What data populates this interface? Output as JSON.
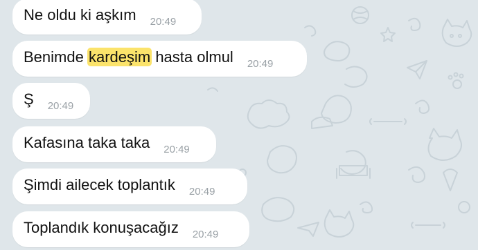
{
  "colors": {
    "wallpaper": "#dfe6ea",
    "bubble": "#ffffff",
    "text": "#111111",
    "time": "#9aa1a6",
    "highlight": "#fbe36b"
  },
  "messages": [
    {
      "text": "Ne oldu ki aşkım",
      "time": "20:49"
    },
    {
      "pre": "Benimde ",
      "highlight": "kardeşim",
      "post": " hasta olmul",
      "time": "20:49"
    },
    {
      "text": "Ş",
      "time": "20:49"
    },
    {
      "text": "Kafasına taka taka",
      "time": "20:49"
    },
    {
      "text": "Şimdi ailecek toplantık",
      "time": "20:49"
    },
    {
      "text": "Toplandık konuşacağız",
      "time": "20:49"
    }
  ]
}
